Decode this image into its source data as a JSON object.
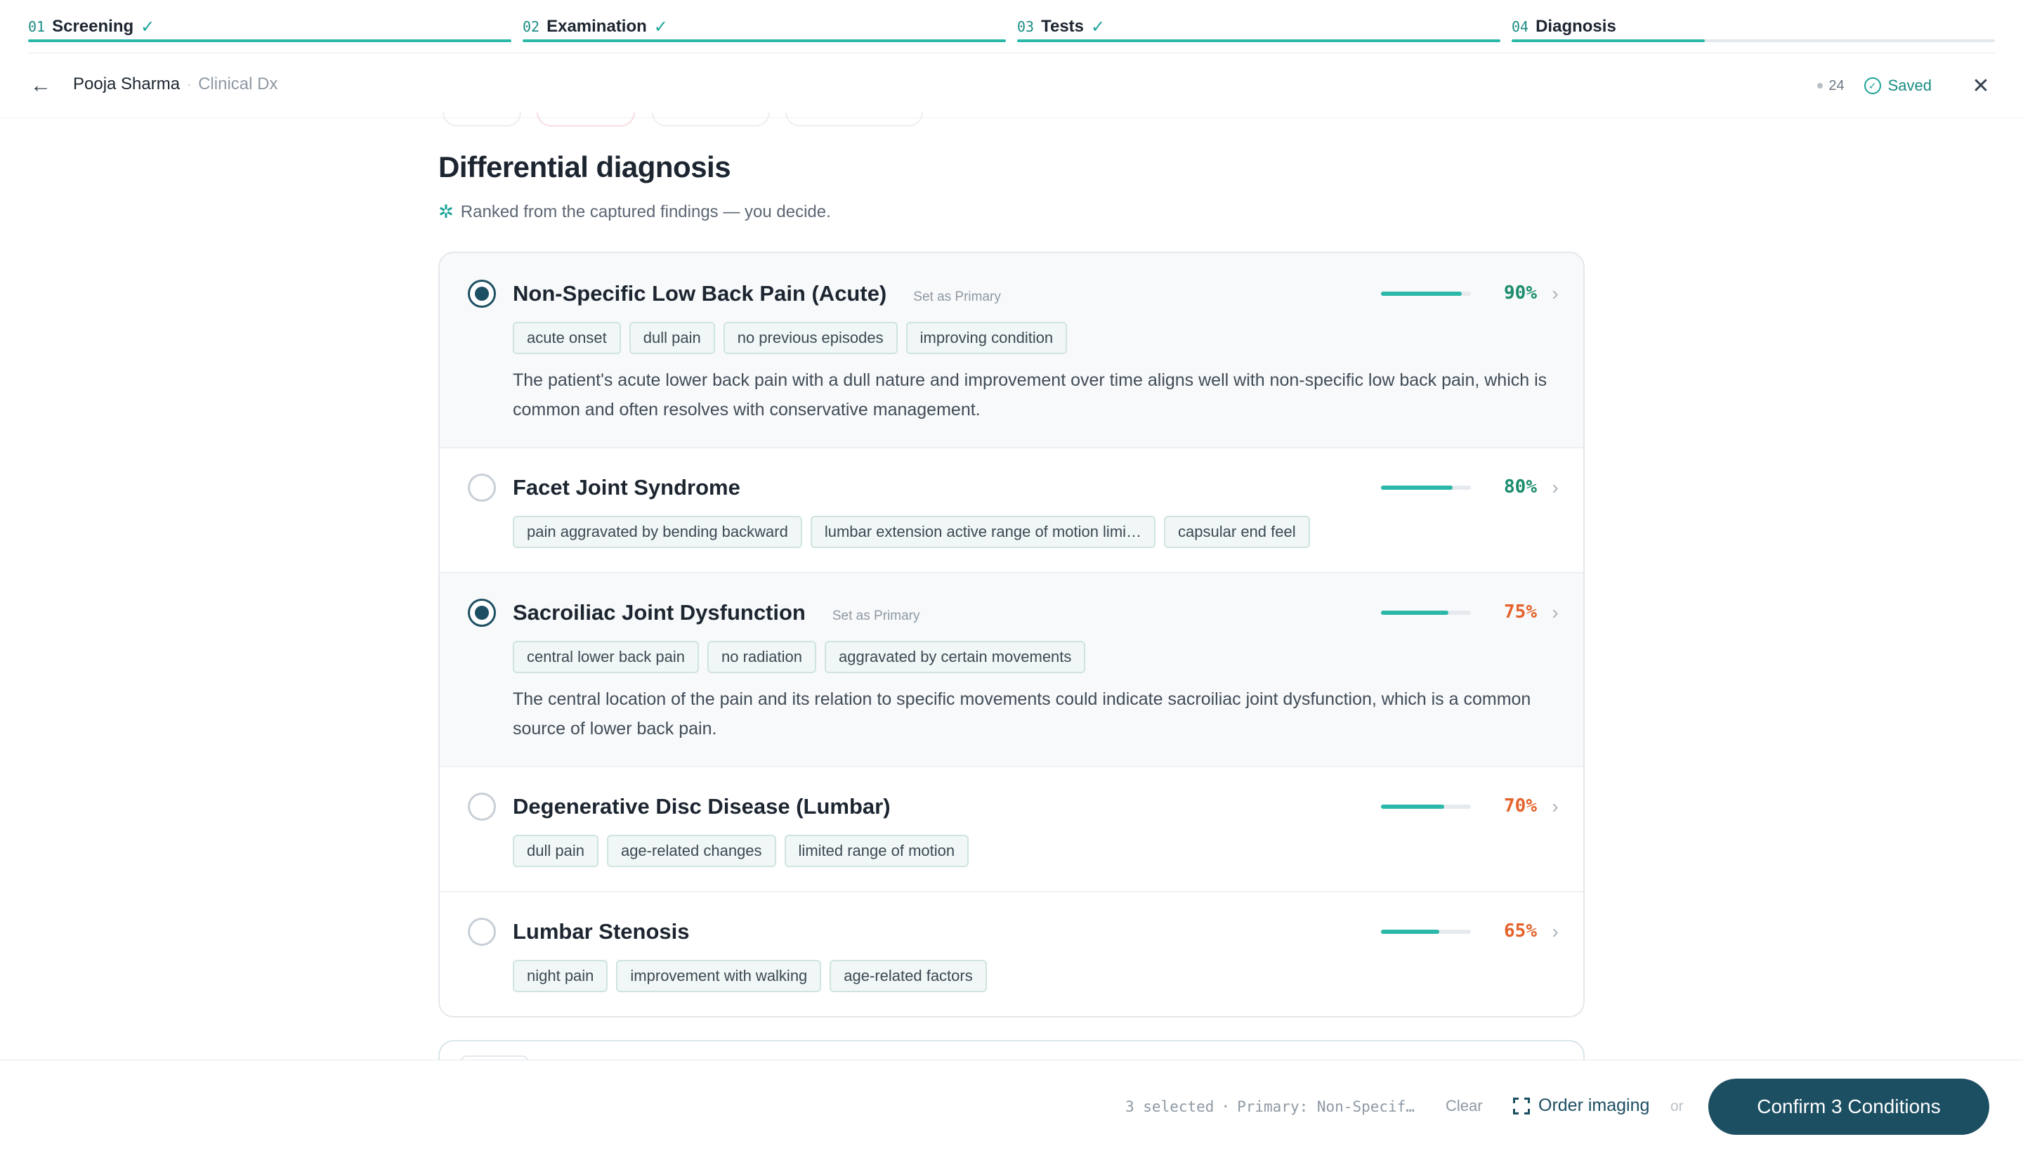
{
  "stepper": {
    "steps": [
      {
        "num": "01",
        "label": "Screening",
        "done": true
      },
      {
        "num": "02",
        "label": "Examination",
        "done": true
      },
      {
        "num": "03",
        "label": "Tests",
        "done": true
      },
      {
        "num": "04",
        "label": "Diagnosis",
        "done": false
      }
    ]
  },
  "header": {
    "patient_name": "Pooja Sharma",
    "separator": "·",
    "module": "Clinical Dx",
    "counter": "24",
    "saved_label": "Saved"
  },
  "main": {
    "title": "Differential diagnosis",
    "subtitle": "Ranked from the captured findings — you decide."
  },
  "conditions": [
    {
      "name": "Non-Specific Low Back Pain (Acute)",
      "selected": true,
      "action": "Set as Primary",
      "confidence": 0.9,
      "confidence_label": "90%",
      "confidence_color": "#1a8c6c",
      "chips": [
        "acute onset",
        "dull pain",
        "no previous episodes",
        "improving condition"
      ],
      "description": "The patient's acute lower back pain with a dull nature and improvement over time aligns well with non-specific low back pain, which is common and often resolves with conservative management."
    },
    {
      "name": "Facet Joint Syndrome",
      "selected": false,
      "action": "",
      "confidence": 0.8,
      "confidence_label": "80%",
      "confidence_color": "#1a8c6c",
      "chips": [
        "pain aggravated by bending backward",
        "lumbar extension active range of motion limi…",
        "capsular end feel"
      ],
      "description": ""
    },
    {
      "name": "Sacroiliac Joint Dysfunction",
      "selected": true,
      "action": "Set as Primary",
      "confidence": 0.75,
      "confidence_label": "75%",
      "confidence_color": "#e4622a",
      "chips": [
        "central lower back pain",
        "no radiation",
        "aggravated by certain movements"
      ],
      "description": "The central location of the pain and its relation to specific movements could indicate sacroiliac joint dysfunction, which is a common source of lower back pain."
    },
    {
      "name": "Degenerative Disc Disease (Lumbar)",
      "selected": false,
      "action": "",
      "confidence": 0.7,
      "confidence_label": "70%",
      "confidence_color": "#e4622a",
      "chips": [
        "dull pain",
        "age-related changes",
        "limited range of motion"
      ],
      "description": ""
    },
    {
      "name": "Lumbar Stenosis",
      "selected": false,
      "action": "",
      "confidence": 0.65,
      "confidence_label": "65%",
      "confidence_color": "#e4622a",
      "chips": [
        "night pain",
        "improvement with walking",
        "age-related factors"
      ],
      "description": ""
    }
  ],
  "footer": {
    "selected_count": "3 selected",
    "dot": "·",
    "primary": "Primary: Non-Specif…",
    "clear_label": "Clear",
    "order_label": "Order imaging",
    "or_label": "or",
    "confirm_label": "Confirm 3 Conditions"
  }
}
